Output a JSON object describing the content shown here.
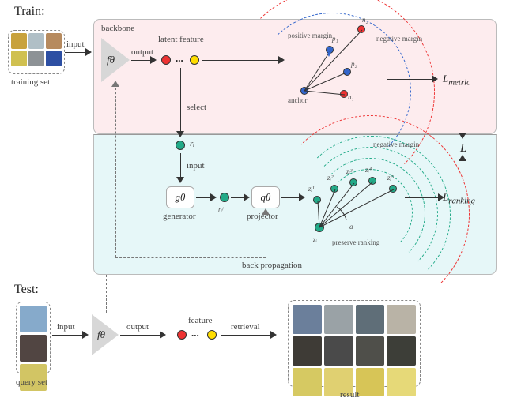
{
  "train": {
    "title": "Train:",
    "training_set_label": "training set",
    "input_label": "input",
    "backbone_label": "backbone",
    "fn": "fθ",
    "output_label": "output",
    "latent_feature_label": "latent feature",
    "ellipsis": "...",
    "metric": {
      "anchor": "anchor",
      "p1": "p₁",
      "p2": "p₂",
      "n1": "n₁",
      "n2": "n₂",
      "pos_margin": "positive margin",
      "neg_margin": "negative margin",
      "loss": "L",
      "loss_sub": "metric"
    },
    "select_label": "select",
    "ri": "rᵢ",
    "input2_label": "input",
    "g_fn": "gθ",
    "generator_label": "generator",
    "ri_j": "rᵢʲ",
    "q_fn": "qθ",
    "projector_label": "projector",
    "ranking": {
      "zi": "zᵢ",
      "z1": "zᵢ¹",
      "z2": "zᵢ²",
      "z3": "zᵢ³",
      "z4": "zᵢ⁴",
      "z5": "zᵢ⁵",
      "neg_margin": "negative margin",
      "alpha": "a",
      "preserve": "preserve ranking",
      "loss": "L",
      "loss_sub": "ranking"
    },
    "total_loss": "L",
    "backprop": "back propagation"
  },
  "test": {
    "title": "Test:",
    "query_set_label": "query set",
    "input_label": "input",
    "fn": "fθ",
    "output_label": "output",
    "feature_label": "feature",
    "ellipsis": "...",
    "retrieval_label": "retrieval",
    "result_label": "result"
  },
  "colors": {
    "thumbs_train": [
      "#c8a23d",
      "#b0bfc6",
      "#b68a5e",
      "#d0c050",
      "#8d9296",
      "#2d4fa3"
    ],
    "thumbs_query": [
      "#86aacb",
      "#514542",
      "#d2c564"
    ],
    "thumbs_result": [
      "#6b7f9b",
      "#9aa2a6",
      "#5f6e78",
      "#b9b3a6",
      "#3e3b36",
      "#4a4a4a",
      "#4f4f4a",
      "#3d3e38",
      "#d6c962",
      "#e0d071",
      "#d7c557",
      "#e6d978"
    ]
  }
}
